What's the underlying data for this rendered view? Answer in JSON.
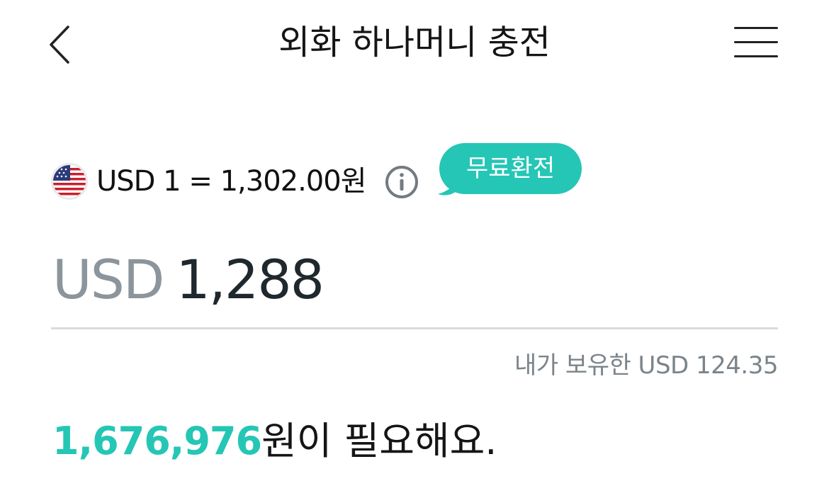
{
  "header": {
    "title": "외화 하나머니 충전"
  },
  "rate": {
    "flag": "us-flag-icon",
    "text": "USD 1 = 1,302.00원",
    "badge": "무료환전"
  },
  "amount": {
    "currency": "USD",
    "value": "1,288"
  },
  "holding": {
    "text": "내가 보유한 USD 124.35"
  },
  "required": {
    "amount": "1,676,976",
    "suffix": "원이 필요해요."
  },
  "colors": {
    "accent": "#25c6b5",
    "muted": "#8c959c",
    "divider": "#d8dadd"
  }
}
